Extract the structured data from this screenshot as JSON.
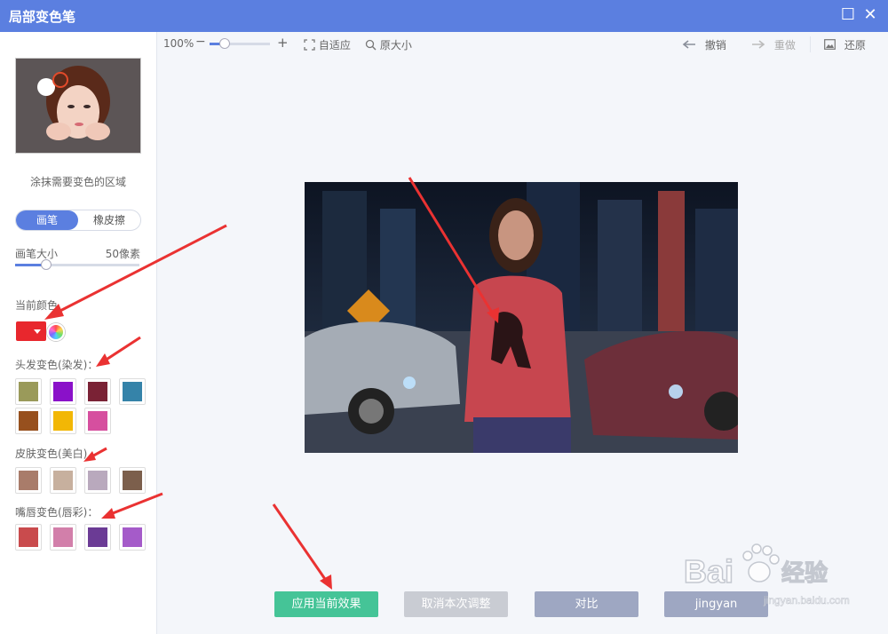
{
  "window": {
    "title": "局部变色笔",
    "maximize_glyph": "☐",
    "close_glyph": "✕"
  },
  "sidebar": {
    "hint": "涂抹需要变色的区域",
    "tools": [
      {
        "label": "画笔",
        "active": true
      },
      {
        "label": "橡皮擦",
        "active": false
      }
    ],
    "brush_size_label": "画笔大小",
    "brush_size_value": "50像素",
    "brush_size_fraction": 0.25,
    "current_color_label": "当前颜色",
    "current_color": "#e8272d",
    "groups": [
      {
        "label": "头发变色(染发)：",
        "colors": [
          "#9a9a5a",
          "#8a11c9",
          "#7a2235",
          "#3583a9",
          "#97501e",
          "#f2b705",
          "#d64f9f"
        ]
      },
      {
        "label": "皮肤变色(美白)",
        "colors": [
          "#a97c6a",
          "#c7b09e",
          "#b9a9bd",
          "#7c5f4c"
        ]
      },
      {
        "label": "嘴唇变色(唇彩)：",
        "colors": [
          "#c94b4d",
          "#d27faa",
          "#6b3b95",
          "#a55bc9"
        ]
      }
    ]
  },
  "toolbar": {
    "zoom_percent": "100%",
    "zoom_minus": "−",
    "zoom_plus": "+",
    "zoom_fraction": 0.25,
    "fit_label": "自适应",
    "original_label": "原大小",
    "undo_label": "撤销",
    "redo_label": "重做",
    "restore_label": "还原"
  },
  "actions": {
    "apply": "应用当前效果",
    "cancel": "取消本次调整",
    "compare": "对比",
    "fourth": "jingyan"
  },
  "watermark": {
    "brand": "Bai",
    "brand2": "经验",
    "url": "jingyan.baidu.com"
  },
  "colors": {
    "accent": "#5b7fe0",
    "apply_bg": "#45c497",
    "cancel_bg": "#c9ccd3",
    "compare_bg": "#9ea7c2",
    "fourth_bg": "#9ea7c2"
  }
}
